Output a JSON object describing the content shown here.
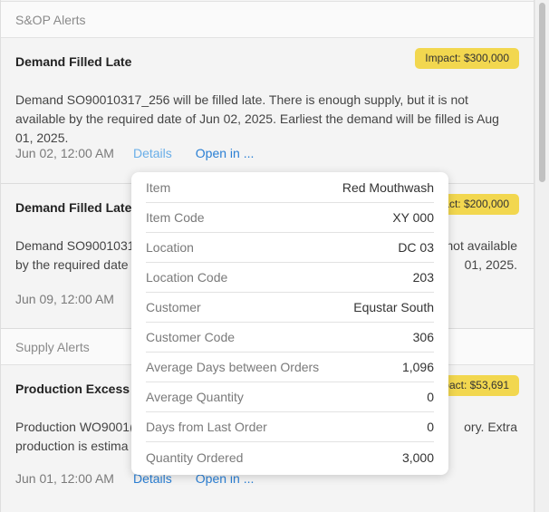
{
  "sections": {
    "sop_header": "S&OP Alerts",
    "supply_header": "Supply Alerts"
  },
  "cards": [
    {
      "title": "Demand Filled Late",
      "impact": "Impact: $300,000",
      "desc": "Demand SO90010317_256 will be filled late. There is enough supply, but it is not available by the required date of Jun 02, 2025. Earliest the demand will be filled is Aug 01, 2025.",
      "date": "Jun 02, 12:00 AM",
      "details": "Details",
      "open": "Open in ..."
    },
    {
      "title": "Demand Filled Late",
      "impact": "Impact: $200,000",
      "desc_line1_left": "Demand SO9001031",
      "desc_line1_right": "not available",
      "desc_line2_left": "by the required date o",
      "desc_line2_right": "01, 2025.",
      "date": "Jun 09, 12:00 AM"
    },
    {
      "title": "Production Excess",
      "impact": "Impact: $53,691",
      "desc_line1_left": "Production WO9001(",
      "desc_line1_right": "ory. Extra",
      "desc_line2_left": "production is estima",
      "date": "Jun 01, 12:00 AM",
      "details": "Details",
      "open": "Open in ..."
    }
  ],
  "popup": {
    "rows": [
      {
        "label": "Item",
        "value": "Red Mouthwash"
      },
      {
        "label": "Item Code",
        "value": "XY 000"
      },
      {
        "label": "Location",
        "value": "DC 03"
      },
      {
        "label": "Location Code",
        "value": "203"
      },
      {
        "label": "Customer",
        "value": "Equstar South"
      },
      {
        "label": "Customer Code",
        "value": "306"
      },
      {
        "label": "Average Days between Orders",
        "value": "1,096"
      },
      {
        "label": "Average Quantity",
        "value": "0"
      },
      {
        "label": "Days from Last Order",
        "value": "0"
      },
      {
        "label": "Quantity Ordered",
        "value": "3,000"
      }
    ]
  },
  "colors": {
    "impact_badge": "#f2d74f",
    "link": "#2a7fd4"
  }
}
